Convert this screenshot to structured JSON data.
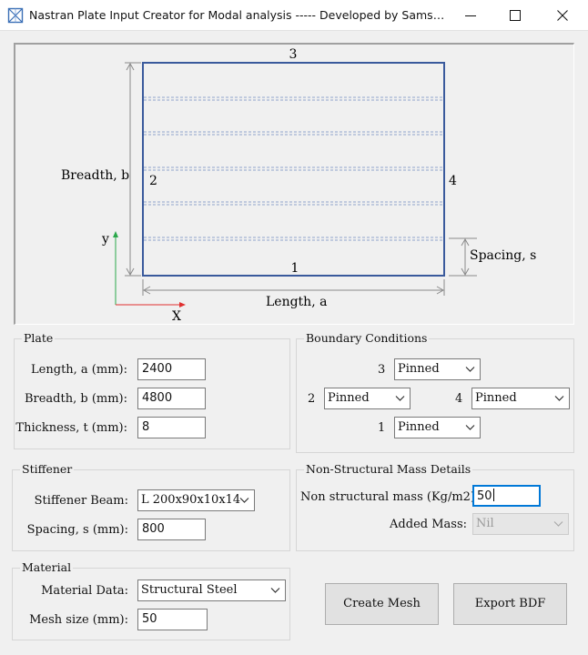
{
  "window": {
    "title": "Nastran Plate Input Creator for Modal analysis ----- Developed by Samson M..."
  },
  "diagram": {
    "edge_top": "3",
    "edge_bottom": "1",
    "edge_left": "2",
    "edge_right": "4",
    "breadth_label": "Breadth, b",
    "length_label": "Length, a",
    "spacing_label": "Spacing, s",
    "axis_x": "X",
    "axis_y": "y"
  },
  "plate": {
    "title": "Plate",
    "length_label": "Length, a (mm):",
    "length_value": "2400",
    "breadth_label": "Breadth, b (mm):",
    "breadth_value": "4800",
    "thickness_label": "Thickness, t (mm):",
    "thickness_value": "8"
  },
  "boundary": {
    "title": "Boundary Conditions",
    "edge3_label": "3",
    "edge3_value": "Pinned",
    "edge2_label": "2",
    "edge2_value": "Pinned",
    "edge4_label": "4",
    "edge4_value": "Pinned",
    "edge1_label": "1",
    "edge1_value": "Pinned"
  },
  "stiffener": {
    "title": "Stiffener",
    "beam_label": "Stiffener Beam:",
    "beam_value": "L 200x90x10x14",
    "spacing_label": "Spacing, s (mm):",
    "spacing_value": "800"
  },
  "nsm": {
    "title": "Non-Structural Mass Details",
    "mass_label": "Non structural mass (Kg/m2):",
    "mass_value": "50",
    "added_label": "Added Mass:",
    "added_value": "Nil"
  },
  "material": {
    "title": "Material",
    "data_label": "Material Data:",
    "data_value": "Structural Steel",
    "mesh_label": "Mesh size (mm):",
    "mesh_value": "50"
  },
  "actions": {
    "create_mesh": "Create Mesh",
    "export_bdf": "Export BDF"
  },
  "colors": {
    "plate_outline": "#3a5a9c",
    "stiffener_dash": "#8fa4cc",
    "focus_border": "#0078d7"
  }
}
